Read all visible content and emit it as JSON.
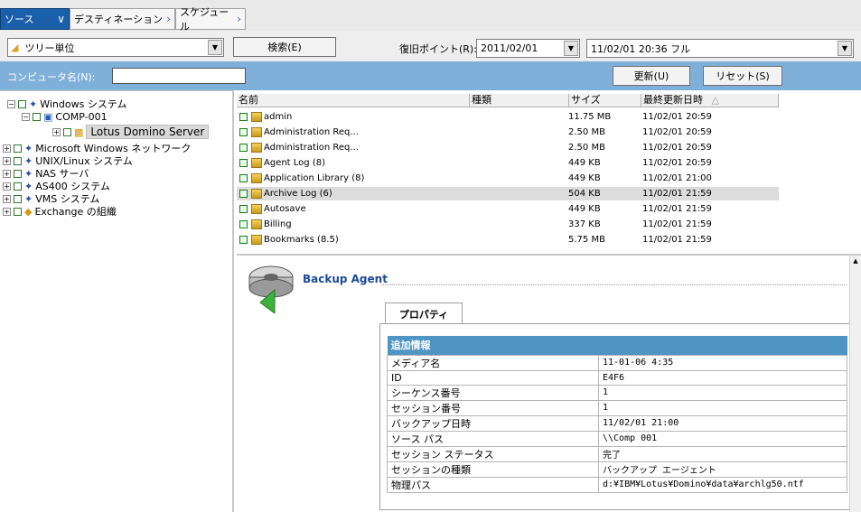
{
  "tabs": [
    {
      "label": "ソース"
    },
    {
      "label": "デスティネーション"
    },
    {
      "label": "スケジュール"
    }
  ],
  "toolbar": {
    "view_mode": "ツリー単位",
    "search_button": "検索(E)",
    "restore_point_label": "復旧ポイント(R):",
    "restore_date": "2011/02/01",
    "restore_session": "11/02/01 20:36  フル"
  },
  "filter": {
    "computer_label": "コンピュータ名(N):",
    "computer_value": "",
    "refresh_button": "更新(U)",
    "reset_button": "リセット(S)"
  },
  "tree": [
    {
      "label": "Windows システム"
    },
    {
      "label": "COMP-001"
    },
    {
      "label": "Lotus Domino Server"
    },
    {
      "label": "Microsoft Windows ネットワーク"
    },
    {
      "label": "UNIX/Linux システム"
    },
    {
      "label": "NAS サーバ"
    },
    {
      "label": "AS400 システム"
    },
    {
      "label": "VMS システム"
    },
    {
      "label": "Exchange の組織"
    }
  ],
  "file_list": {
    "columns": [
      "名前",
      "種類",
      "サイズ",
      "最終更新日時"
    ],
    "rows": [
      {
        "name": "admin",
        "size": "11.75 MB",
        "date": "11/02/01  20:59"
      },
      {
        "name": "Administration Req...",
        "size": "2.50 MB",
        "date": "11/02/01  20:59"
      },
      {
        "name": "Administration Req...",
        "size": "2.50 MB",
        "date": "11/02/01  20:59"
      },
      {
        "name": "Agent Log (8)",
        "size": "449 KB",
        "date": "11/02/01  20:59"
      },
      {
        "name": "Application Library (8)",
        "size": "449 KB",
        "date": "11/02/01  21:00"
      },
      {
        "name": "Archive Log (6)",
        "size": "504 KB",
        "date": "11/02/01  21:59"
      },
      {
        "name": "Autosave",
        "size": "449 KB",
        "date": "11/02/01  21:59"
      },
      {
        "name": "Billing",
        "size": "337 KB",
        "date": "11/02/01  21:59"
      },
      {
        "name": "Bookmarks (8.5)",
        "size": "5.75 MB",
        "date": "11/02/01  21:59"
      }
    ]
  },
  "properties": {
    "agent_title": "Backup Agent",
    "tab_label": "プロパティ",
    "section_title": "追加情報",
    "rows": [
      {
        "key": "メディア名",
        "value": "11-01-06 4:35"
      },
      {
        "key": "ID",
        "value": "E4F6"
      },
      {
        "key": "シーケンス番号",
        "value": "1"
      },
      {
        "key": "セッション番号",
        "value": "1"
      },
      {
        "key": "バックアップ日時",
        "value": "11/02/01 21:00"
      },
      {
        "key": "ソース パス",
        "value": "\\\\Comp 001"
      },
      {
        "key": "セッション ステータス",
        "value": "完了"
      },
      {
        "key": "セッションの種類",
        "value": "バックアップ エージェント"
      },
      {
        "key": "物理パス",
        "value": "d:¥IBM¥Lotus¥Domino¥data¥archlg50.ntf"
      }
    ]
  }
}
